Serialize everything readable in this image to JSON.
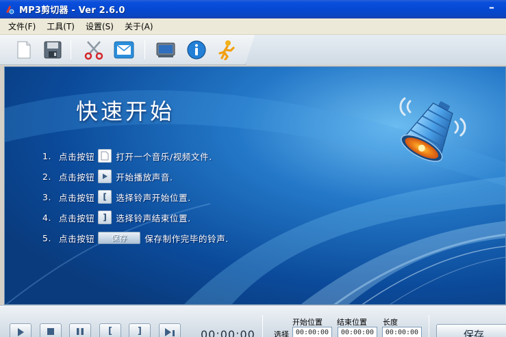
{
  "window": {
    "title": "MP3剪切器 - Ver 2.6.0"
  },
  "menu": {
    "items": [
      {
        "label": "文件(F)"
      },
      {
        "label": "工具(T)"
      },
      {
        "label": "设置(S)"
      },
      {
        "label": "关于(A)"
      }
    ]
  },
  "toolbar": {
    "buttons": [
      {
        "icon": "new-file-icon"
      },
      {
        "icon": "save-disk-icon"
      },
      {
        "icon": "scissors-icon"
      },
      {
        "icon": "mail-icon"
      },
      {
        "icon": "monitor-icon"
      },
      {
        "icon": "info-icon"
      },
      {
        "icon": "running-man-icon"
      }
    ]
  },
  "quickstart": {
    "title": "快速开始",
    "steps": [
      {
        "num": "1.",
        "prefix": "点击按钮",
        "suffix": "打开一个音乐/视频文件."
      },
      {
        "num": "2.",
        "prefix": "点击按钮",
        "suffix": "开始播放声音."
      },
      {
        "num": "3.",
        "prefix": "点击按钮",
        "button_glyph": "[",
        "suffix": "选择铃声开始位置."
      },
      {
        "num": "4.",
        "prefix": "点击按钮",
        "button_glyph": "]",
        "suffix": "选择铃声结束位置."
      },
      {
        "num": "5.",
        "prefix": "点击按钮",
        "button_label": "保存",
        "suffix": "保存制作完毕的铃声."
      }
    ]
  },
  "controls": {
    "time": "00:00:00",
    "start_label": "开始位置",
    "end_label": "结束位置",
    "length_label": "长度",
    "select_label": "选择",
    "start_value": "00:00:00",
    "end_value": "00:00:00",
    "length_value": "00:00:00",
    "save_label": "保存",
    "mark_start_glyph": "[",
    "mark_end_glyph": "]"
  },
  "colors": {
    "titlebar": "#0548d2",
    "panel": "#0b4f9b",
    "accent_orange": "#f28a1a"
  }
}
